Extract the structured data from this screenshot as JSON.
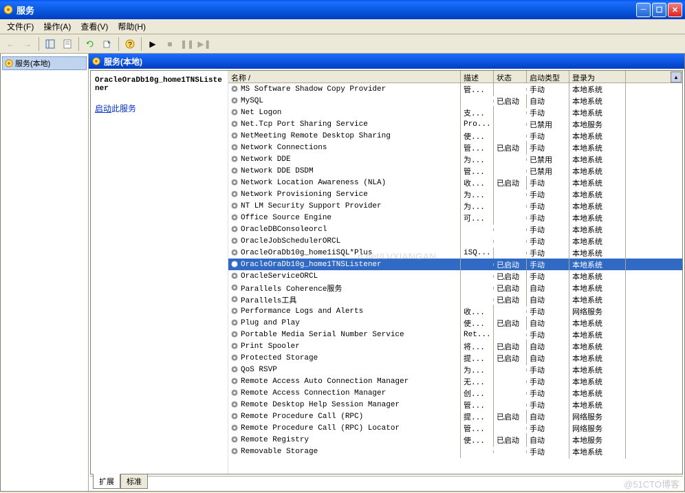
{
  "window": {
    "title": "服务"
  },
  "menu": {
    "file": "文件(F)",
    "action": "操作(A)",
    "view": "查看(V)",
    "help": "帮助(H)"
  },
  "tree": {
    "root": "服务(本地)"
  },
  "content_header": "服务(本地)",
  "detail": {
    "title": "OracleOraDb10g_home1TNSListener",
    "start_prefix": "启动",
    "start_suffix": "此服务"
  },
  "columns": {
    "name": "名称  /",
    "desc": "描述",
    "status": "状态",
    "startup": "启动类型",
    "logon": "登录为"
  },
  "tabs": {
    "ext": "扩展",
    "std": "标准"
  },
  "watermark": "n.net/LVXIANGAN",
  "wblog": "@51CTO博客",
  "services": [
    {
      "name": "MS Software Shadow Copy Provider",
      "desc": "管...",
      "status": "",
      "startup": "手动",
      "logon": "本地系统"
    },
    {
      "name": "MySQL",
      "desc": "",
      "status": "已启动",
      "startup": "自动",
      "logon": "本地系统"
    },
    {
      "name": "Net Logon",
      "desc": "支...",
      "status": "",
      "startup": "手动",
      "logon": "本地系统"
    },
    {
      "name": "Net.Tcp Port Sharing Service",
      "desc": "Pro...",
      "status": "",
      "startup": "已禁用",
      "logon": "本地服务"
    },
    {
      "name": "NetMeeting Remote Desktop Sharing",
      "desc": "使...",
      "status": "",
      "startup": "手动",
      "logon": "本地系统"
    },
    {
      "name": "Network Connections",
      "desc": "管...",
      "status": "已启动",
      "startup": "手动",
      "logon": "本地系统"
    },
    {
      "name": "Network DDE",
      "desc": "为...",
      "status": "",
      "startup": "已禁用",
      "logon": "本地系统"
    },
    {
      "name": "Network DDE DSDM",
      "desc": "管...",
      "status": "",
      "startup": "已禁用",
      "logon": "本地系统"
    },
    {
      "name": "Network Location Awareness (NLA)",
      "desc": "收...",
      "status": "已启动",
      "startup": "手动",
      "logon": "本地系统"
    },
    {
      "name": "Network Provisioning Service",
      "desc": "为...",
      "status": "",
      "startup": "手动",
      "logon": "本地系统"
    },
    {
      "name": "NT LM Security Support Provider",
      "desc": "为...",
      "status": "",
      "startup": "手动",
      "logon": "本地系统"
    },
    {
      "name": "Office Source Engine",
      "desc": "可...",
      "status": "",
      "startup": "手动",
      "logon": "本地系统"
    },
    {
      "name": "OracleDBConsoleorcl",
      "desc": "",
      "status": "",
      "startup": "手动",
      "logon": "本地系统"
    },
    {
      "name": "OracleJobSchedulerORCL",
      "desc": "",
      "status": "",
      "startup": "手动",
      "logon": "本地系统"
    },
    {
      "name": "OracleOraDb10g_home1iSQL*Plus",
      "desc": "iSQ...",
      "status": "",
      "startup": "手动",
      "logon": "本地系统"
    },
    {
      "name": "OracleOraDb10g_home1TNSListener",
      "desc": "",
      "status": "已启动",
      "startup": "手动",
      "logon": "本地系统",
      "selected": true
    },
    {
      "name": "OracleServiceORCL",
      "desc": "",
      "status": "已启动",
      "startup": "手动",
      "logon": "本地系统"
    },
    {
      "name": "Parallels Coherence服务",
      "desc": "",
      "status": "已启动",
      "startup": "自动",
      "logon": "本地系统"
    },
    {
      "name": "Parallels工具",
      "desc": "",
      "status": "已启动",
      "startup": "自动",
      "logon": "本地系统"
    },
    {
      "name": "Performance Logs and Alerts",
      "desc": "收...",
      "status": "",
      "startup": "手动",
      "logon": "网络服务"
    },
    {
      "name": "Plug and Play",
      "desc": "使...",
      "status": "已启动",
      "startup": "自动",
      "logon": "本地系统"
    },
    {
      "name": "Portable Media Serial Number Service",
      "desc": "Ret...",
      "status": "",
      "startup": "手动",
      "logon": "本地系统"
    },
    {
      "name": "Print Spooler",
      "desc": "将...",
      "status": "已启动",
      "startup": "自动",
      "logon": "本地系统"
    },
    {
      "name": "Protected Storage",
      "desc": "提...",
      "status": "已启动",
      "startup": "自动",
      "logon": "本地系统"
    },
    {
      "name": "QoS RSVP",
      "desc": "为...",
      "status": "",
      "startup": "手动",
      "logon": "本地系统"
    },
    {
      "name": "Remote Access Auto Connection Manager",
      "desc": "无...",
      "status": "",
      "startup": "手动",
      "logon": "本地系统"
    },
    {
      "name": "Remote Access Connection Manager",
      "desc": "创...",
      "status": "",
      "startup": "手动",
      "logon": "本地系统"
    },
    {
      "name": "Remote Desktop Help Session Manager",
      "desc": "管...",
      "status": "",
      "startup": "手动",
      "logon": "本地系统"
    },
    {
      "name": "Remote Procedure Call (RPC)",
      "desc": "提...",
      "status": "已启动",
      "startup": "自动",
      "logon": "网络服务"
    },
    {
      "name": "Remote Procedure Call (RPC) Locator",
      "desc": "管...",
      "status": "",
      "startup": "手动",
      "logon": "网络服务"
    },
    {
      "name": "Remote Registry",
      "desc": "使...",
      "status": "已启动",
      "startup": "自动",
      "logon": "本地服务"
    },
    {
      "name": "Removable Storage",
      "desc": "",
      "status": "",
      "startup": "手动",
      "logon": "本地系统"
    }
  ]
}
